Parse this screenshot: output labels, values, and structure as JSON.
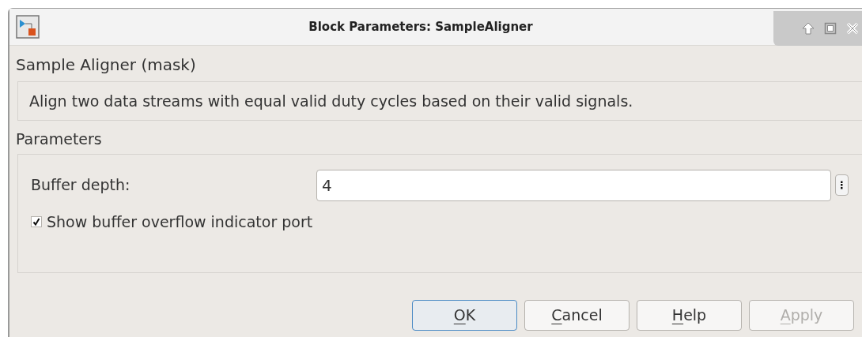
{
  "window": {
    "title": "Block Parameters: SampleAligner"
  },
  "mask_title": "Sample Aligner (mask)",
  "description": "Align two data streams with equal valid duty cycles based on their valid signals.",
  "parameters": {
    "heading": "Parameters",
    "fields": [
      {
        "kind": "text",
        "label": "Buffer depth:",
        "value": "4",
        "more": "⋮"
      },
      {
        "kind": "checkbox",
        "label": "Show buffer overflow indicator port",
        "checked": true
      }
    ]
  },
  "buttons": [
    {
      "label": "OK",
      "default": true,
      "disabled": false,
      "mnemonic": true
    },
    {
      "label": "Cancel",
      "default": false,
      "disabled": false,
      "mnemonic": true
    },
    {
      "label": "Help",
      "default": false,
      "disabled": false,
      "mnemonic": true
    },
    {
      "label": "Apply",
      "default": false,
      "disabled": true,
      "mnemonic": true
    }
  ]
}
